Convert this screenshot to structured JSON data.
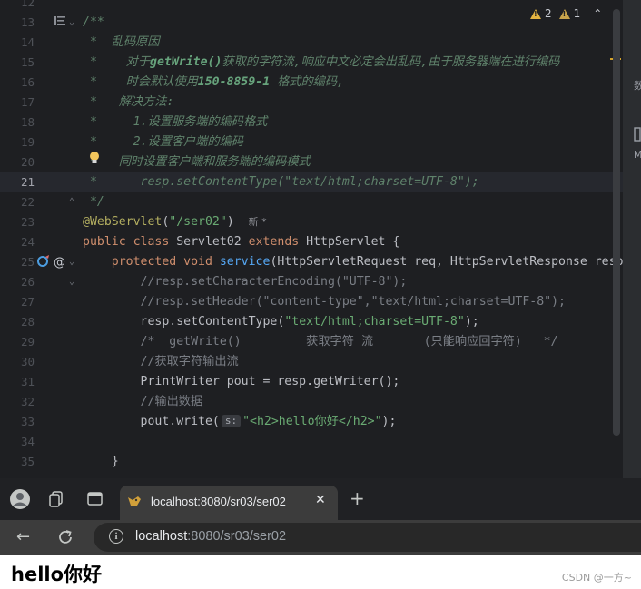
{
  "editor": {
    "inspections": {
      "warnings": "2",
      "weak_warnings": "1"
    },
    "lines": [
      {
        "num": "12",
        "parts": []
      },
      {
        "num": "13",
        "parts": [
          {
            "c": "c-doc",
            "t": "/**"
          }
        ]
      },
      {
        "num": "14",
        "parts": [
          {
            "c": "c-doc",
            "t": " *  乱码原因"
          }
        ]
      },
      {
        "num": "15",
        "parts": [
          {
            "c": "c-doc",
            "t": " *    对于"
          },
          {
            "c": "c-doctag",
            "t": "getWrite()"
          },
          {
            "c": "c-doc",
            "t": "获取的字符流,响应中文必定会出乱码,由于服务器端在进行编码"
          }
        ]
      },
      {
        "num": "16",
        "parts": [
          {
            "c": "c-doc",
            "t": " *    时会默认使用"
          },
          {
            "c": "c-doctag",
            "t": "150-8859-1"
          },
          {
            "c": "c-doc",
            "t": " 格式的编码,"
          }
        ]
      },
      {
        "num": "17",
        "parts": [
          {
            "c": "c-doc",
            "t": " *   解决方法:"
          }
        ]
      },
      {
        "num": "18",
        "parts": [
          {
            "c": "c-doc",
            "t": " *     1.设置服务端的编码格式"
          }
        ]
      },
      {
        "num": "19",
        "parts": [
          {
            "c": "c-doc",
            "t": " *     2.设置客户端的编码"
          }
        ]
      },
      {
        "num": "20",
        "parts": [
          {
            "c": "c-doc",
            "t": " *   同时设置客户端和服务端的编码模式"
          }
        ]
      },
      {
        "num": "21",
        "parts": [
          {
            "c": "c-doc",
            "t": " *      resp.setContentType(\"text/html;charset=UTF-8\");"
          }
        ]
      },
      {
        "num": "22",
        "parts": [
          {
            "c": "c-doc",
            "t": " */"
          }
        ]
      },
      {
        "num": "23",
        "parts": [
          {
            "c": "c-ann",
            "t": "@WebServlet"
          },
          {
            "c": "",
            "t": "("
          },
          {
            "c": "c-str",
            "t": "\"/ser02\""
          },
          {
            "c": "",
            "t": ")  "
          },
          {
            "c": "c-ann-meta",
            "t": "新 *"
          }
        ]
      },
      {
        "num": "24",
        "parts": [
          {
            "c": "c-kw",
            "t": "public class "
          },
          {
            "c": "",
            "t": "Servlet02 "
          },
          {
            "c": "c-kw",
            "t": "extends "
          },
          {
            "c": "",
            "t": "HttpServlet {"
          }
        ]
      },
      {
        "num": "25",
        "parts": [
          {
            "c": "",
            "t": "    "
          },
          {
            "c": "c-kw",
            "t": "protected void "
          },
          {
            "c": "c-fn",
            "t": "service"
          },
          {
            "c": "",
            "t": "(HttpServletRequest req, HttpServletResponse resp)"
          }
        ]
      },
      {
        "num": "26",
        "parts": [
          {
            "c": "",
            "t": "        "
          },
          {
            "c": "c-cmt",
            "t": "//resp.setCharacterEncoding(\"UTF-8\");"
          }
        ]
      },
      {
        "num": "27",
        "parts": [
          {
            "c": "",
            "t": "        "
          },
          {
            "c": "c-cmt",
            "t": "//resp.setHeader(\"content-type\",\"text/html;charset=UTF-8\");"
          }
        ]
      },
      {
        "num": "28",
        "parts": [
          {
            "c": "",
            "t": "        resp.setContentType("
          },
          {
            "c": "c-str",
            "t": "\"text/html;charset=UTF-8\""
          },
          {
            "c": "",
            "t": ");"
          }
        ]
      },
      {
        "num": "29",
        "parts": [
          {
            "c": "",
            "t": "        "
          },
          {
            "c": "c-cmt",
            "t": "/*  getWrite()         获取字符 流       (只能响应回字符)   */"
          }
        ]
      },
      {
        "num": "30",
        "parts": [
          {
            "c": "",
            "t": "        "
          },
          {
            "c": "c-cmt",
            "t": "//获取字符输出流"
          }
        ]
      },
      {
        "num": "31",
        "parts": [
          {
            "c": "",
            "t": "        PrintWriter pout = resp.getWriter();"
          }
        ]
      },
      {
        "num": "32",
        "parts": [
          {
            "c": "",
            "t": "        "
          },
          {
            "c": "c-cmt",
            "t": "//输出数据"
          }
        ]
      },
      {
        "num": "33",
        "parts": [
          {
            "c": "",
            "t": "        pout.write("
          },
          {
            "c": "param-hint",
            "t": "s:"
          },
          {
            "c": "c-str",
            "t": "\"<h2>hello你好</h2>\""
          },
          {
            "c": "",
            "t": ");"
          }
        ]
      },
      {
        "num": "34",
        "parts": []
      },
      {
        "num": "35",
        "parts": [
          {
            "c": "",
            "t": "    }"
          }
        ]
      }
    ],
    "current_line_index": 9
  },
  "right_panel": {
    "label1": "数",
    "label2": "M"
  },
  "browser": {
    "tab_title": "localhost:8080/sr03/ser02",
    "address_host": "localhost",
    "address_path": ":8080/sr03/ser02",
    "page_heading": "hello你好",
    "watermark": "CSDN @一方~"
  },
  "colors": {
    "editor_bg": "#1e1f22",
    "keyword": "#cf8e6d",
    "string": "#6aab73",
    "comment": "#7a7e85",
    "doc_comment": "#5f826b",
    "annotation": "#b3ae60",
    "method": "#56a8f5",
    "warning": "#e3b341"
  }
}
